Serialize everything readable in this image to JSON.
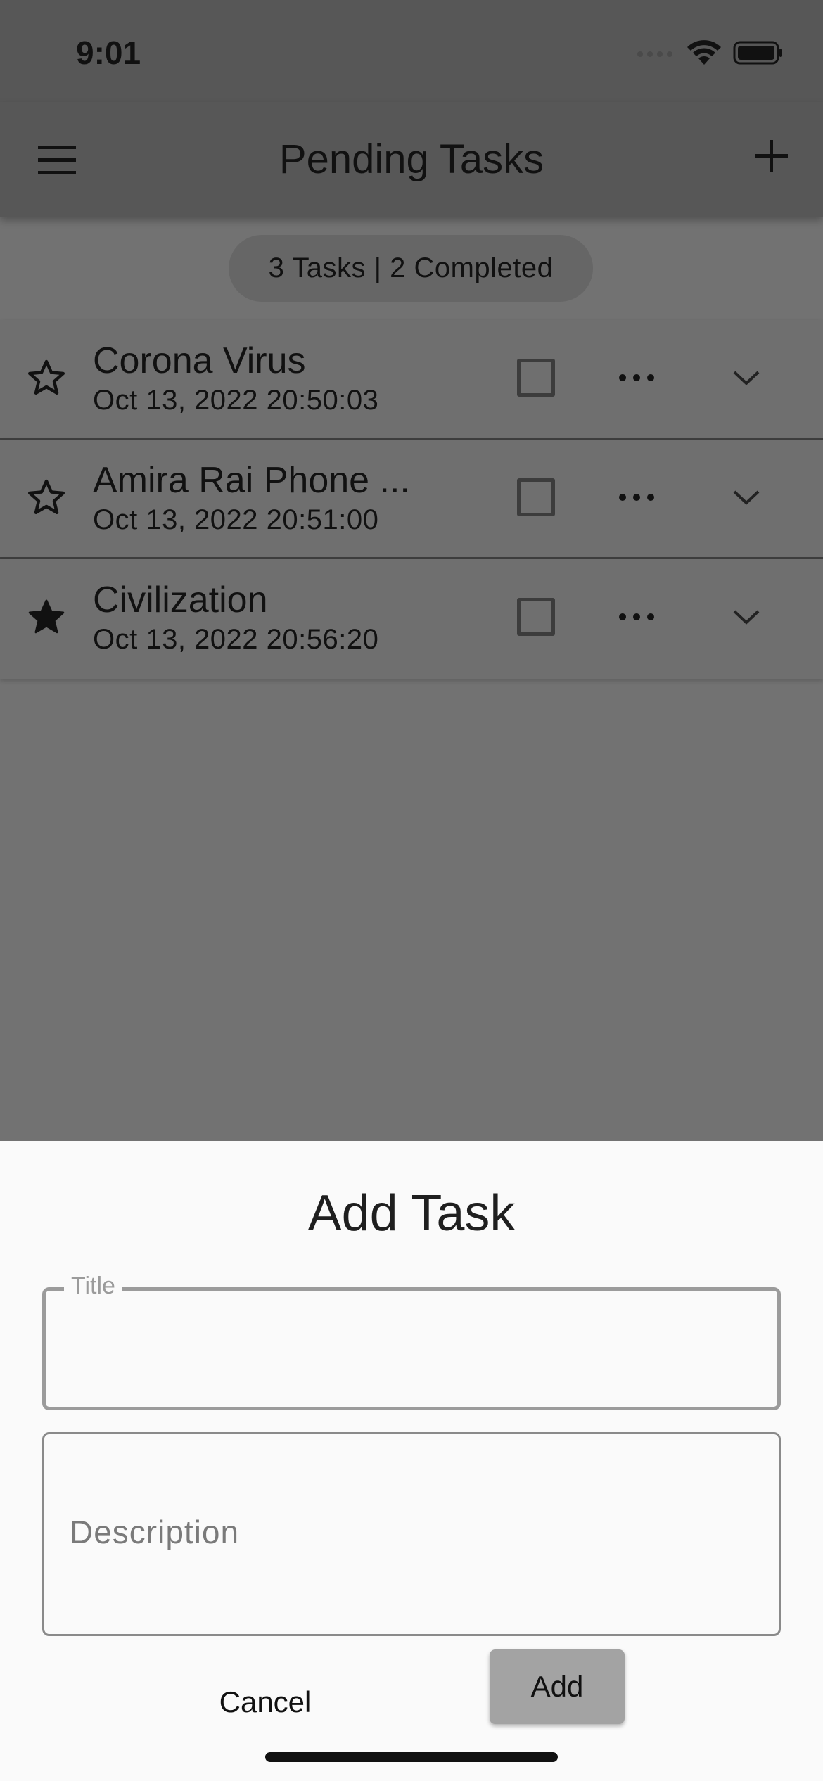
{
  "status_bar": {
    "time": "9:01"
  },
  "app_bar": {
    "title": "Pending Tasks"
  },
  "summary": {
    "text": "3 Tasks | 2 Completed"
  },
  "tasks": [
    {
      "title": "Corona Virus",
      "date": "Oct 13, 2022 20:50:03",
      "starred": false,
      "checked": false
    },
    {
      "title": "Amira Rai Phone ...",
      "date": "Oct 13, 2022 20:51:00",
      "starred": false,
      "checked": false
    },
    {
      "title": "Civilization",
      "date": "Oct 13, 2022 20:56:20",
      "starred": true,
      "checked": false
    }
  ],
  "sheet": {
    "title": "Add Task",
    "title_field_label": "Title",
    "title_field_value": "",
    "description_placeholder": "Description",
    "description_value": "",
    "cancel_label": "Cancel",
    "add_label": "Add"
  },
  "icons": {
    "menu": "hamburger-menu-icon",
    "add": "plus-icon",
    "star_outline": "star-outline-icon",
    "star_filled": "star-filled-icon",
    "more": "more-horizontal-icon",
    "expand": "chevron-down-icon"
  }
}
